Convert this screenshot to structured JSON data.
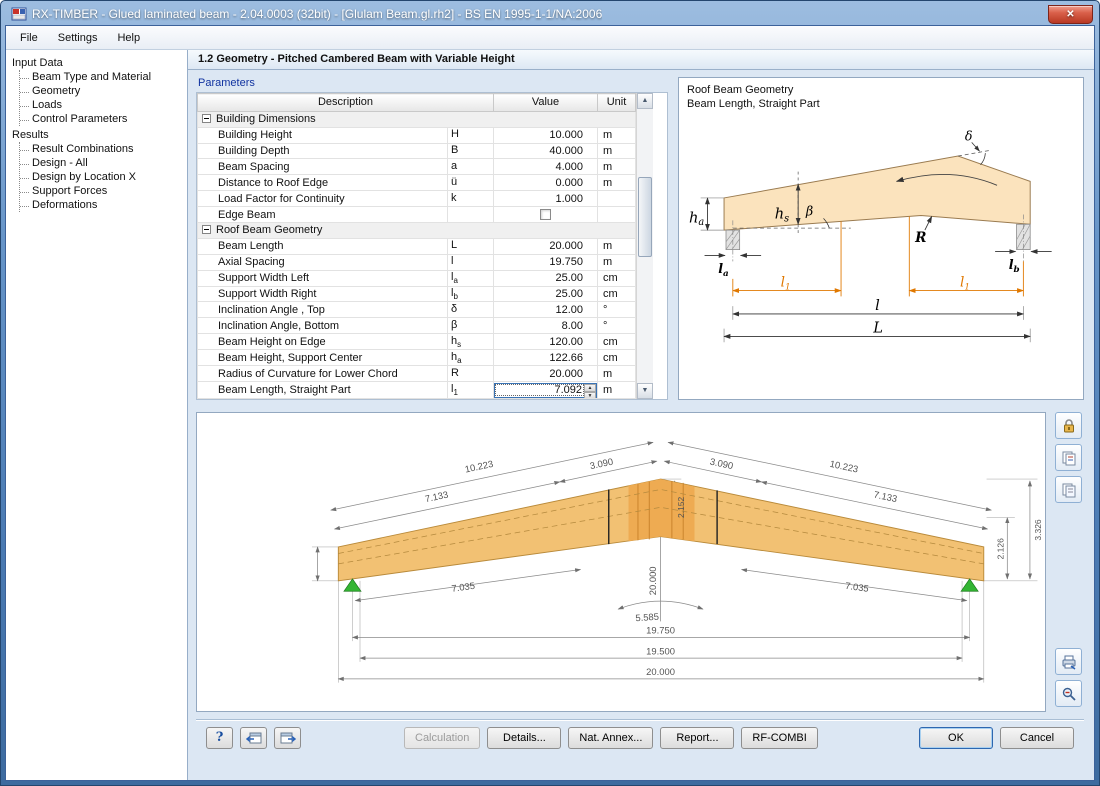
{
  "window": {
    "title": "RX-TIMBER - Glued laminated beam - 2.04.0003 (32bit) - [Glulam Beam.gl.rh2] - BS EN 1995-1-1/NA:2006",
    "menu": [
      "File",
      "Settings",
      "Help"
    ],
    "icons": {
      "close": "✕",
      "help": "?",
      "up": "▲",
      "down": "▼"
    }
  },
  "sidebar": {
    "sections": [
      {
        "label": "Input Data",
        "items": [
          "Beam Type and Material",
          "Geometry",
          "Loads",
          "Control Parameters"
        ]
      },
      {
        "label": "Results",
        "items": [
          "Result Combinations",
          "Design - All",
          "Design by Location X",
          "Support Forces",
          "Deformations"
        ]
      }
    ]
  },
  "main": {
    "section_title": "1.2 Geometry  -  Pitched Cambered Beam with Variable Height",
    "parameters": {
      "group_label": "Parameters",
      "columns": [
        "Description",
        "Value",
        "Unit"
      ],
      "rows": [
        {
          "type": "group",
          "label": "Building Dimensions"
        },
        {
          "desc": "Building Height",
          "sym": "H",
          "sub": "",
          "value": "10.000",
          "unit": "m"
        },
        {
          "desc": "Building Depth",
          "sym": "B",
          "sub": "",
          "value": "40.000",
          "unit": "m"
        },
        {
          "desc": "Beam Spacing",
          "sym": "a",
          "sub": "",
          "value": "4.000",
          "unit": "m"
        },
        {
          "desc": "Distance to Roof Edge",
          "sym": "ü",
          "sub": "",
          "value": "0.000",
          "unit": "m"
        },
        {
          "desc": "Load Factor for Continuity",
          "sym": "k",
          "sub": "",
          "value": "1.000",
          "unit": ""
        },
        {
          "type": "check",
          "desc": "Edge Beam",
          "sym": "",
          "sub": "",
          "value": "",
          "unit": "",
          "checked": false
        },
        {
          "type": "group",
          "label": "Roof Beam Geometry"
        },
        {
          "desc": "Beam Length",
          "sym": "L",
          "sub": "",
          "value": "20.000",
          "unit": "m"
        },
        {
          "desc": "Axial Spacing",
          "sym": "l",
          "sub": "",
          "value": "19.750",
          "unit": "m"
        },
        {
          "desc": "Support Width Left",
          "sym": "l",
          "sub": "a",
          "value": "25.00",
          "unit": "cm"
        },
        {
          "desc": "Support Width Right",
          "sym": "l",
          "sub": "b",
          "value": "25.00",
          "unit": "cm"
        },
        {
          "desc": "Inclination Angle , Top",
          "sym": "δ",
          "sub": "",
          "value": "12.00",
          "unit": "°"
        },
        {
          "desc": "Inclination Angle, Bottom",
          "sym": "β",
          "sub": "",
          "value": "8.00",
          "unit": "°"
        },
        {
          "desc": "Beam Height on Edge",
          "sym": "h",
          "sub": "s",
          "value": "120.00",
          "unit": "cm"
        },
        {
          "desc": "Beam Height, Support Center",
          "sym": "h",
          "sub": "a",
          "value": "122.66",
          "unit": "cm"
        },
        {
          "desc": "Radius of Curvature for Lower Chord",
          "sym": "R",
          "sub": "",
          "value": "20.000",
          "unit": "m"
        },
        {
          "desc": "Beam Length, Straight Part",
          "sym": "l",
          "sub": "1",
          "value": "7.092",
          "unit": "m"
        }
      ]
    }
  },
  "diagram": {
    "title_line1": "Roof Beam Geometry",
    "title_line2": "Beam Length, Straight Part",
    "labels": {
      "delta": "δ",
      "beta": "β",
      "ha_base": "h",
      "ha_sub": "a",
      "hs_base": "h",
      "hs_sub": "s",
      "la_base": "l",
      "la_sub": "a",
      "lb_base": "l",
      "lb_sub": "b",
      "l1_base": "l",
      "l1_sub": "1",
      "radius": "R",
      "axial": "l",
      "total": "L"
    }
  },
  "drawing": {
    "dims": {
      "top_outer_left": "10.223",
      "top_inner_left": "7.133",
      "top_apex_left": "3.090",
      "top_apex_right": "3.090",
      "top_inner_right": "7.133",
      "top_outer_right": "10.223",
      "apex_height": "2.152",
      "right_upper": "2.126",
      "right_total": "3.326",
      "radius": "20.000",
      "arc_length": "5.585",
      "bottom_left": "7.035",
      "bottom_right": "7.035",
      "span_axial": "19.750",
      "span_clear": "19.500",
      "span_total": "20.000"
    }
  },
  "footer": {
    "calculation": "Calculation",
    "details": "Details...",
    "nat_annex": "Nat. Annex...",
    "report": "Report...",
    "rf_combi": "RF-COMBI",
    "ok": "OK",
    "cancel": "Cancel"
  },
  "colors": {
    "titlebar_blue": "#4a7ab2",
    "beam_fill": "#f2c173",
    "beam_fill_light": "#fbe3bd",
    "dimension_orange": "#e07800",
    "support_green": "#33b533"
  }
}
